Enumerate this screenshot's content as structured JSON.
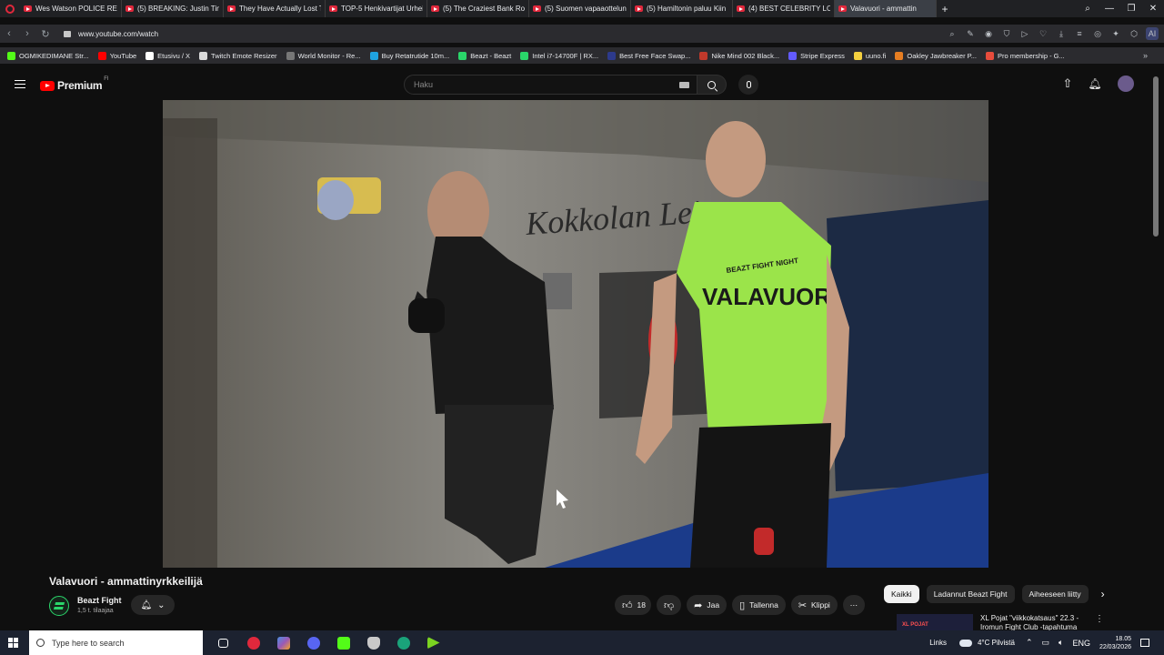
{
  "browser": {
    "tabs": [
      {
        "title": "Wes Watson POLICE REPO",
        "active": false
      },
      {
        "title": "(5) BREAKING: Justin Timb",
        "active": false
      },
      {
        "title": "They Have Actually Lost T",
        "active": false
      },
      {
        "title": "TOP-5 Henkivartijat Urhei",
        "active": false
      },
      {
        "title": "(5) The Craziest Bank Robi",
        "active": false
      },
      {
        "title": "(5) Suomen vapaaottelun",
        "active": false
      },
      {
        "title": "(5) Hamiltonin paluu Kiin",
        "active": false
      },
      {
        "title": "(4) BEST CELEBRITY LOOK",
        "active": false
      },
      {
        "title": "Valavuori - ammattin",
        "active": true
      }
    ],
    "new_tab": "+",
    "url": "www.youtube.com/watch",
    "aria_label": "AI",
    "bookmarks": [
      {
        "label": "OGMIKEDIMANE Str...",
        "color": "#53fc18"
      },
      {
        "label": "YouTube",
        "color": "#ff0000"
      },
      {
        "label": "Etusivu / X",
        "color": "#ffffff"
      },
      {
        "label": "Twitch Emote Resizer",
        "color": "#d9d9d9"
      },
      {
        "label": "World Monitor - Re...",
        "color": "#777777"
      },
      {
        "label": "Buy Retatrutide 10m...",
        "color": "#1fa3e0"
      },
      {
        "label": "Beazt - Beazt",
        "color": "#2ad66a"
      },
      {
        "label": "Intel i7-14700F | RX...",
        "color": "#2ad66a"
      },
      {
        "label": "Best Free Face Swap...",
        "color": "#2d3a8c"
      },
      {
        "label": "Nike Mind 002 Black...",
        "color": "#c0392b"
      },
      {
        "label": "Stripe Express",
        "color": "#635bff"
      },
      {
        "label": "uuno.fi",
        "color": "#f4d03f"
      },
      {
        "label": "Oakley Jawbreaker P...",
        "color": "#e67e22"
      },
      {
        "label": "Pro membership - G...",
        "color": "#e74c3c"
      }
    ]
  },
  "youtube": {
    "brand": "Premium",
    "brand_sup": "FI",
    "search_placeholder": "Haku",
    "video": {
      "title": "Valavuori - ammattinyrkkeilijä",
      "channel": "Beazt Fight",
      "subscribers": "1,5 t. tilaajaa",
      "likes": "18",
      "share": "Jaa",
      "save": "Tallenna",
      "clip": "Klippi",
      "shirt_text": "VALAVUORI",
      "shirt_logo": "BEAZT FIGHT NIGHT",
      "wall_text": "Kokkolan Leipu"
    },
    "chips": [
      {
        "label": "Kaikki",
        "selected": true
      },
      {
        "label": "Ladannut Beazt Fight",
        "selected": false
      },
      {
        "label": "Aiheeseen liitty",
        "selected": false
      }
    ],
    "recommendation": {
      "thumb_text": "XL POJAT",
      "title": "XL Pojat \"viikkokatsaus\" 22.3 - Iromun Fight Club -tapahtuma"
    }
  },
  "taskbar": {
    "search_placeholder": "Type here to search",
    "links": "Links",
    "weather": "4°C  Pilvistä",
    "lang": "ENG",
    "time": "18.05",
    "date": "22/03/2026"
  }
}
